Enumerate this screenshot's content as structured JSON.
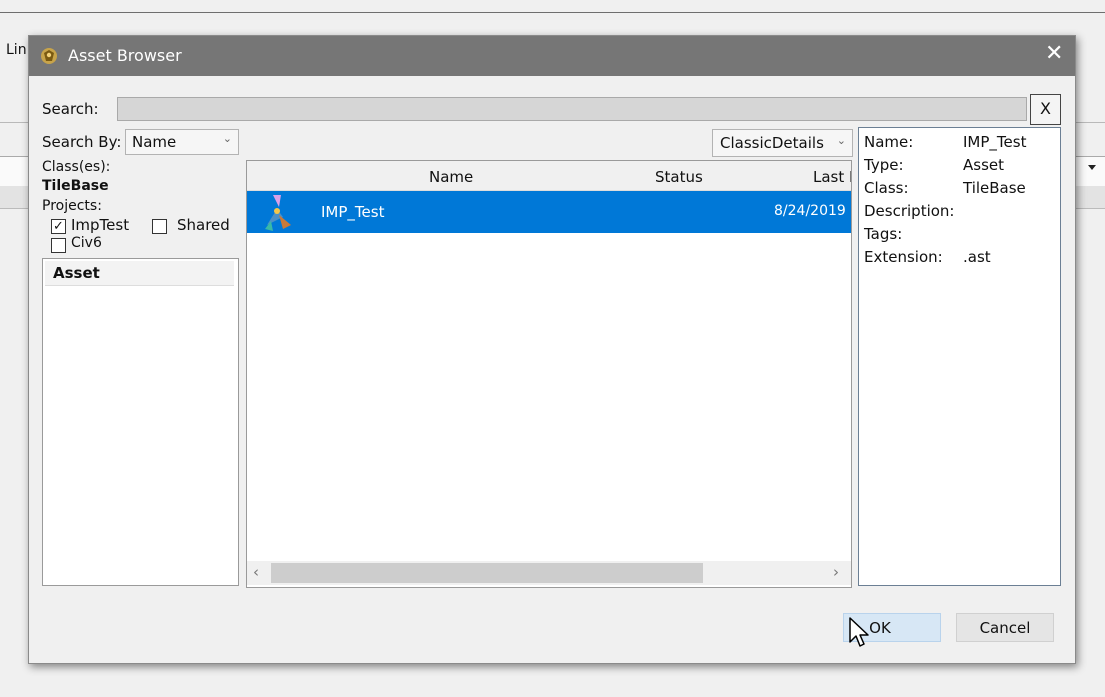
{
  "background": {
    "clipped_label": "Lin"
  },
  "dialog": {
    "title": "Asset Browser",
    "close_glyph": "✕",
    "search": {
      "label": "Search:",
      "value": "",
      "clear_label": "X"
    },
    "search_by": {
      "label": "Search By:",
      "selected": "Name"
    },
    "classes": {
      "label": "Class(es):",
      "value": "TileBase"
    },
    "projects": {
      "label": "Projects:",
      "items": [
        {
          "label": "ImpTest",
          "checked": true
        },
        {
          "label": "Shared",
          "checked": false
        },
        {
          "label": "Civ6",
          "checked": false
        }
      ]
    },
    "type_list": {
      "header": "Asset"
    },
    "view_mode": {
      "selected": "ClassicDetails"
    },
    "results": {
      "columns": [
        "Name",
        "Status",
        "Last M"
      ],
      "rows": [
        {
          "name": "IMP_Test",
          "status": "",
          "date": "8/24/2019",
          "selected": true
        }
      ]
    },
    "details": {
      "rows": [
        {
          "key": "Name:",
          "value": "IMP_Test"
        },
        {
          "key": "Type:",
          "value": "Asset"
        },
        {
          "key": "Class:",
          "value": "TileBase"
        },
        {
          "key": "Description:",
          "value": ""
        },
        {
          "key": "Tags:",
          "value": ""
        },
        {
          "key": "Extension:",
          "value": ".ast"
        }
      ]
    },
    "buttons": {
      "ok": "OK",
      "cancel": "Cancel"
    },
    "icons": {
      "app": "civ-app-icon",
      "asset": "asset-icon",
      "cursor": "mouse-pointer-icon"
    },
    "colors": {
      "titlebar": "#767676",
      "selection": "#0078d7"
    }
  }
}
